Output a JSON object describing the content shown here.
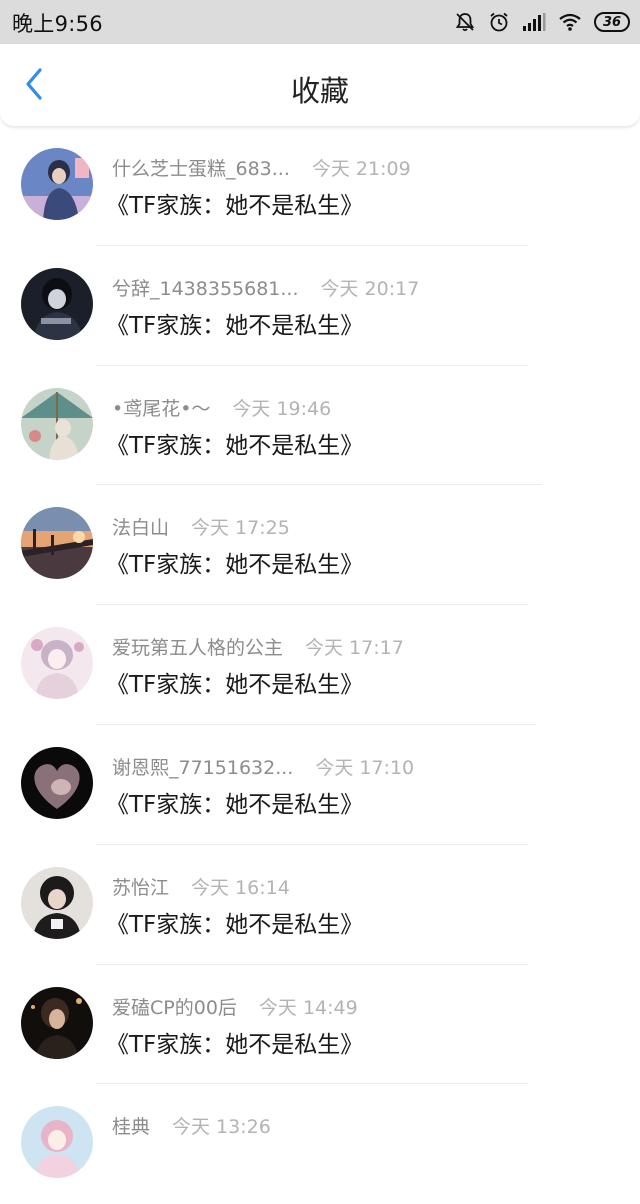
{
  "status_bar": {
    "time": "晚上9:56",
    "battery": "36",
    "icons": [
      "mute-bell-icon",
      "alarm-icon",
      "signal-icon",
      "wifi-icon",
      "battery-icon"
    ]
  },
  "header": {
    "title": "收藏",
    "back_icon": "chevron-left-icon",
    "accent_color": "#2d8cf0"
  },
  "favorites": [
    {
      "user": "什么芝士蛋糕_683...",
      "time": "今天 21:09",
      "title": "《TF家族：她不是私生》"
    },
    {
      "user": "兮辞_1438355681...",
      "time": "今天 20:17",
      "title": "《TF家族：她不是私生》"
    },
    {
      "user": "•鸢尾花•～",
      "time": "今天 19:46",
      "title": "《TF家族：她不是私生》"
    },
    {
      "user": "法白山",
      "time": "今天 17:25",
      "title": "《TF家族：她不是私生》"
    },
    {
      "user": "爱玩第五人格的公主",
      "time": "今天 17:17",
      "title": "《TF家族：她不是私生》"
    },
    {
      "user": "谢恩熙_77151632...",
      "time": "今天 17:10",
      "title": "《TF家族：她不是私生》"
    },
    {
      "user": "苏怡江",
      "time": "今天 16:14",
      "title": "《TF家族：她不是私生》"
    },
    {
      "user": "爱磕CP的00后",
      "time": "今天 14:49",
      "title": "《TF家族：她不是私生》"
    },
    {
      "user": "桂典",
      "time": "今天 13:26",
      "title": ""
    }
  ]
}
